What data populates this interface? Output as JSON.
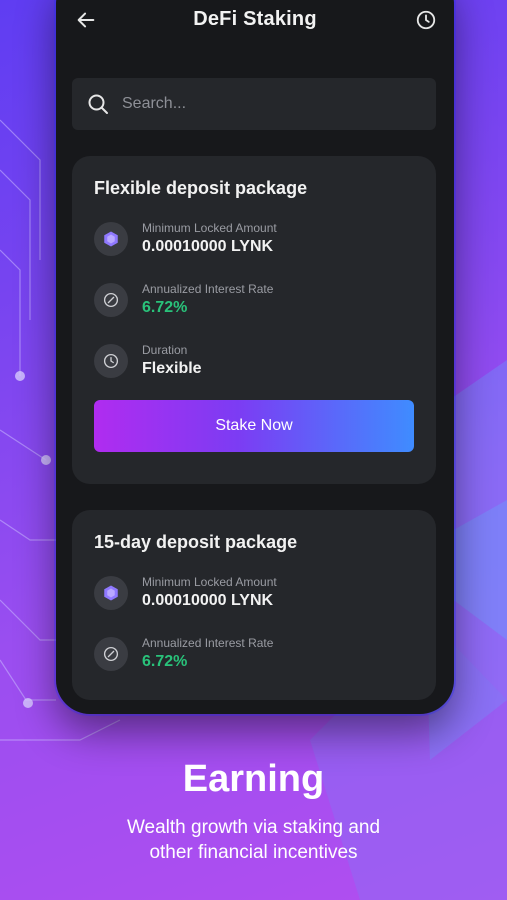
{
  "header": {
    "title": "DeFi Staking",
    "back_icon": "arrow-left-icon",
    "history_icon": "clock-icon"
  },
  "search": {
    "placeholder": "Search...",
    "value": ""
  },
  "packages": [
    {
      "title": "Flexible deposit package",
      "min_locked_label": "Minimum Locked Amount",
      "min_locked_value": "0.00010000 LYNK",
      "rate_label": "Annualized Interest Rate",
      "rate_value": "6.72%",
      "duration_label": "Duration",
      "duration_value": "Flexible",
      "button_label": "Stake Now"
    },
    {
      "title": "15-day deposit package",
      "min_locked_label": "Minimum Locked Amount",
      "min_locked_value": "0.00010000 LYNK",
      "rate_label": "Annualized Interest Rate",
      "rate_value": "6.72%"
    }
  ],
  "promo": {
    "heading": "Earning",
    "subtitle_line1": "Wealth growth via staking and",
    "subtitle_line2": "other financial incentives"
  },
  "colors": {
    "accent_green": "#29c27a",
    "card_bg": "#25272b",
    "phone_bg": "#17181b"
  }
}
